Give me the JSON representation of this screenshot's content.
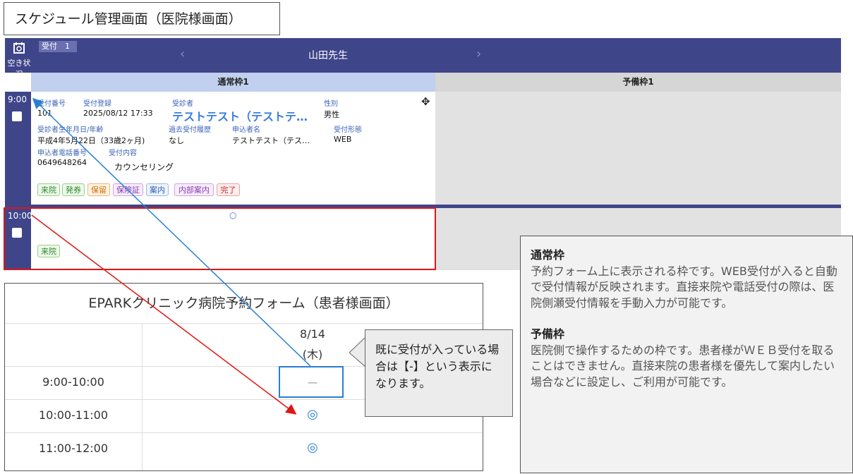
{
  "title": "スケジュール管理画面（医院様画面）",
  "topbar": {
    "vacancy_icon": "search-calendar-icon",
    "vacancy_label": "空き状況",
    "reception_badge": "受付　1",
    "doctor": "山田先生",
    "prev": "‹",
    "next": "›"
  },
  "columns": {
    "regular": "通常枠1",
    "reserve": "予備枠1"
  },
  "slots": {
    "first": {
      "time": "9:00",
      "labels": {
        "number": "受付番号",
        "registered": "受付登録",
        "patient": "受診者",
        "gender": "性別",
        "birth": "受診者生年月日/年齢",
        "history": "過去受付履歴",
        "applicant": "申込者名",
        "form": "受付形態",
        "phone": "申込者電話番号",
        "content": "受付内容"
      },
      "values": {
        "number": "101",
        "registered": "2025/08/12 17:33",
        "patient": "テストテスト（テストテ…",
        "gender": "男性",
        "birth": "平成4年5月22日（33歳2ヶ月)",
        "history": "なし",
        "applicant": "テストテスト（テス…",
        "form": "WEB",
        "phone": "0649648264",
        "content": "カウンセリング"
      },
      "buttons": [
        "来院",
        "発券",
        "保留",
        "保険証",
        "案内",
        "内部案内",
        "完了"
      ]
    },
    "second": {
      "time": "10:00",
      "mark": "○",
      "button": "来院"
    }
  },
  "form": {
    "title": "EPARKクリニック病院予約フォーム（患者様画面）",
    "date": "8/14",
    "weekday": "(木)",
    "rows": [
      {
        "time": "9:00-10:00",
        "status": "ー"
      },
      {
        "time": "10:00-11:00",
        "status": "◎"
      },
      {
        "time": "11:00-12:00",
        "status": "◎"
      }
    ]
  },
  "callout": "既に受付が入っている場合は【-】という表示になります。",
  "info": {
    "regular_title": "通常枠",
    "regular_body": "予約フォーム上に表示される枠です。WEB受付が入ると自動で受付情報が反映されます。直接来院や電話受付の際は、医院側瀬受付情報を手動入力が可能です。",
    "reserve_title": "予備枠",
    "reserve_body": "医院側で操作するための枠です。患者様がＷＥＢ受付を取ることはできません。直接来院の患者様を優先して案内したい場合などに設定し、ご利用が可能です。"
  }
}
